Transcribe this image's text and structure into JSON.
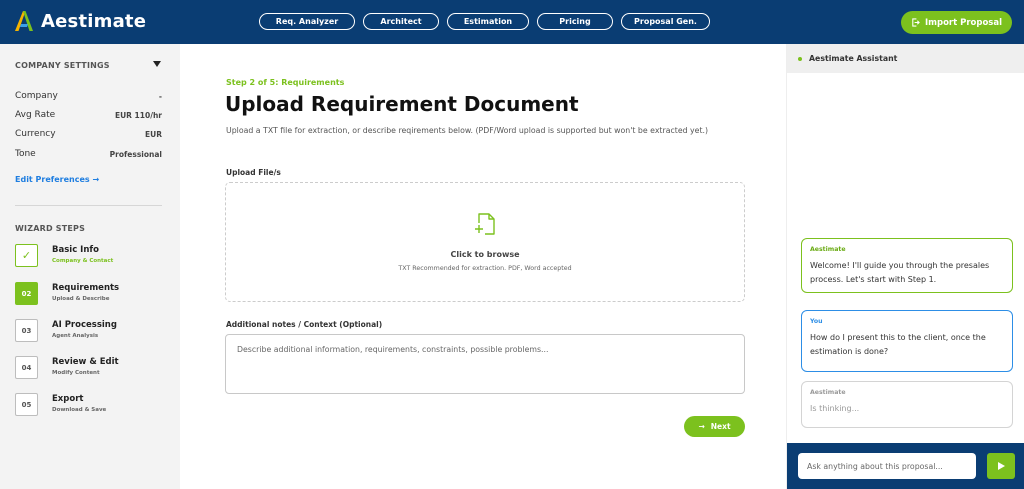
{
  "app": {
    "name": "Aestimate",
    "accent_color": "#7cc11e",
    "header_color": "#0a3d73"
  },
  "nav": {
    "items": [
      {
        "label": "Req. Analyzer"
      },
      {
        "label": "Architect"
      },
      {
        "label": "Estimation"
      },
      {
        "label": "Pricing"
      },
      {
        "label": "Proposal Gen."
      }
    ],
    "import_label": "Import Proposal",
    "import_icon": "import-icon"
  },
  "sidebar": {
    "settings_title": "COMPANY SETTINGS",
    "settings": [
      {
        "label": "Company",
        "value": "-"
      },
      {
        "label": "Avg Rate",
        "value": "EUR 110/hr"
      },
      {
        "label": "Currency",
        "value": "EUR"
      },
      {
        "label": "Tone",
        "value": "Professional"
      }
    ],
    "edit_link": "Edit Preferences →",
    "steps_title": "WIZARD STEPS",
    "steps": [
      {
        "num": "✓",
        "title": "Basic Info",
        "sub": "Company & Contact",
        "status": "done"
      },
      {
        "num": "02",
        "title": "Requirements",
        "sub": "Upload & Describe",
        "status": "active"
      },
      {
        "num": "03",
        "title": "AI Processing",
        "sub": "Agent Analysis",
        "status": "pending"
      },
      {
        "num": "04",
        "title": "Review & Edit",
        "sub": "Modify Content",
        "status": "pending"
      },
      {
        "num": "05",
        "title": "Export",
        "sub": "Download & Save",
        "status": "pending"
      }
    ]
  },
  "main": {
    "step_label": "Step 2 of 5: Requirements",
    "title": "Upload Requirement Document",
    "description": "Upload a TXT file for extraction, or describe reqirements below. (PDF/Word upload is supported but won't be extracted yet.)",
    "upload_label": "Upload File/s",
    "upload_title": "Click to browse",
    "upload_sub": "TXT Recommended for extraction. PDF, Word accepted",
    "notes_label": "Additional notes / Context (Optional)",
    "notes_placeholder": "Describe additional information, requirements, constraints, possible problems...",
    "next_label": "Next",
    "next_icon": "arrow-right-icon"
  },
  "assistant": {
    "title": "Aestimate Assistant",
    "messages": [
      {
        "who": "Aestimate",
        "text": "Welcome! I'll guide you through the presales process. Let's start with Step 1."
      },
      {
        "who": "You",
        "text": "How do I present this to the client, once the estimation is done?"
      },
      {
        "who": "Aestimate",
        "text": "Is thinking..."
      }
    ],
    "input_placeholder": "Ask anything about this proposal...",
    "send_icon": "send-icon"
  }
}
